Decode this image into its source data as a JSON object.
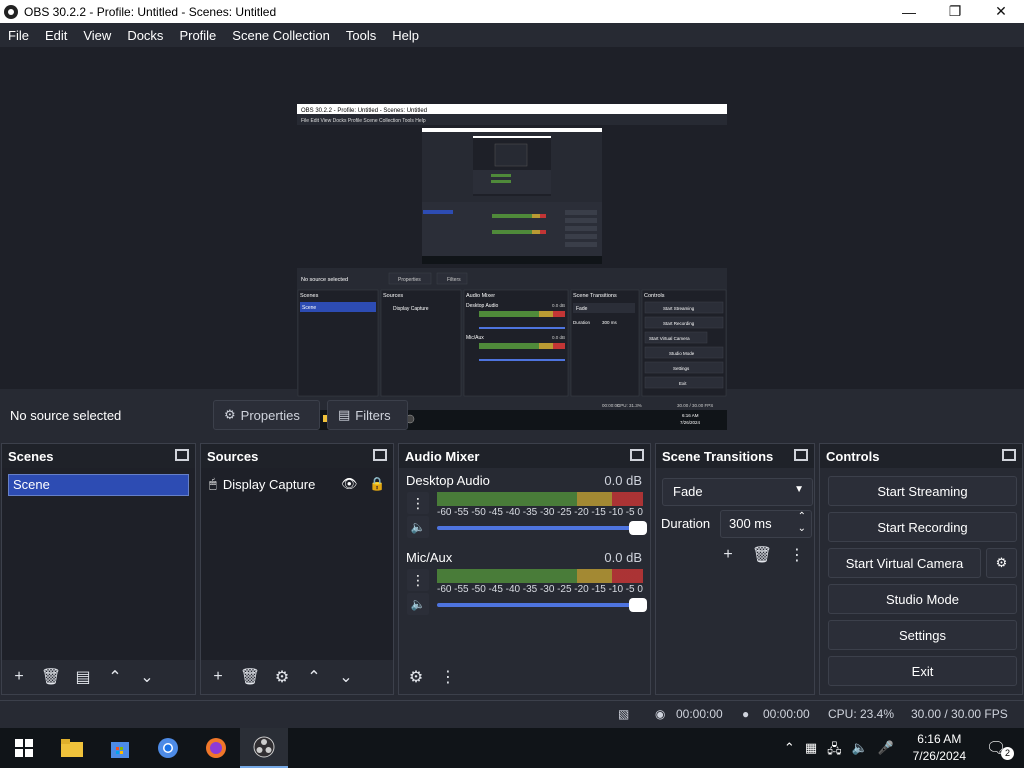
{
  "window": {
    "title": "OBS 30.2.2 - Profile: Untitled - Scenes: Untitled"
  },
  "menu": [
    "File",
    "Edit",
    "View",
    "Docks",
    "Profile",
    "Scene Collection",
    "Tools",
    "Help"
  ],
  "source_toolbar": {
    "no_source": "No source selected",
    "properties": "Properties",
    "filters": "Filters"
  },
  "scenes": {
    "title": "Scenes",
    "items": [
      "Scene"
    ]
  },
  "sources": {
    "title": "Sources",
    "items": [
      "Display Capture"
    ]
  },
  "mixer": {
    "title": "Audio Mixer",
    "channels": [
      {
        "name": "Desktop Audio",
        "db": "0.0 dB"
      },
      {
        "name": "Mic/Aux",
        "db": "0.0 dB"
      }
    ],
    "ticks": [
      "-60",
      "-55",
      "-50",
      "-45",
      "-40",
      "-35",
      "-30",
      "-25",
      "-20",
      "-15",
      "-10",
      "-5",
      "0"
    ]
  },
  "transitions": {
    "title": "Scene Transitions",
    "type": "Fade",
    "duration_label": "Duration",
    "duration": "300 ms"
  },
  "controls": {
    "title": "Controls",
    "start_streaming": "Start Streaming",
    "start_recording": "Start Recording",
    "start_virtual_camera": "Start Virtual Camera",
    "studio_mode": "Studio Mode",
    "settings": "Settings",
    "exit": "Exit"
  },
  "status": {
    "stream_time": "00:00:00",
    "rec_time": "00:00:00",
    "cpu": "CPU: 23.4%",
    "fps": "30.00 / 30.00 FPS"
  },
  "preview_inner": {
    "title": "OBS 30.2.2 - Profile: Untitled - Scenes: Untitled",
    "menu": "File  Edit  View  Docks  Profile  Scene Collection  Tools  Help",
    "no_source": "No source selected",
    "properties": "Properties",
    "filters": "Filters",
    "scenes": "Scenes",
    "sources": "Sources",
    "mixer": "Audio Mixer",
    "transitions": "Scene Transitions",
    "controls": "Controls",
    "scene": "Scene",
    "display_capture": "Display Capture",
    "desktop_audio": "Desktop Audio",
    "mic_aux": "Mic/Aux",
    "db": "0.0 dB",
    "fade": "Fade",
    "duration": "Duration",
    "duration_value": "300 ms",
    "start_streaming": "Start Streaming",
    "start_recording": "Start Recording",
    "start_virtual_camera": "Start Virtual Camera",
    "studio_mode": "Studio Mode",
    "settings": "Settings",
    "exit": "Exit",
    "stream_time": "00:00:00",
    "rec_time": "00:00:00",
    "cpu": "CPU: 31.3%",
    "fps": "30.00 / 30.00 FPS",
    "clock_time": "6:16 AM",
    "clock_date": "7/26/2024"
  },
  "taskbar": {
    "time": "6:16 AM",
    "date": "7/26/2024",
    "notifications": "2"
  },
  "colors": {
    "accent": "#2d4cb3",
    "background": "#272a33",
    "panel": "#1e2028",
    "volume": "#4e74df"
  }
}
